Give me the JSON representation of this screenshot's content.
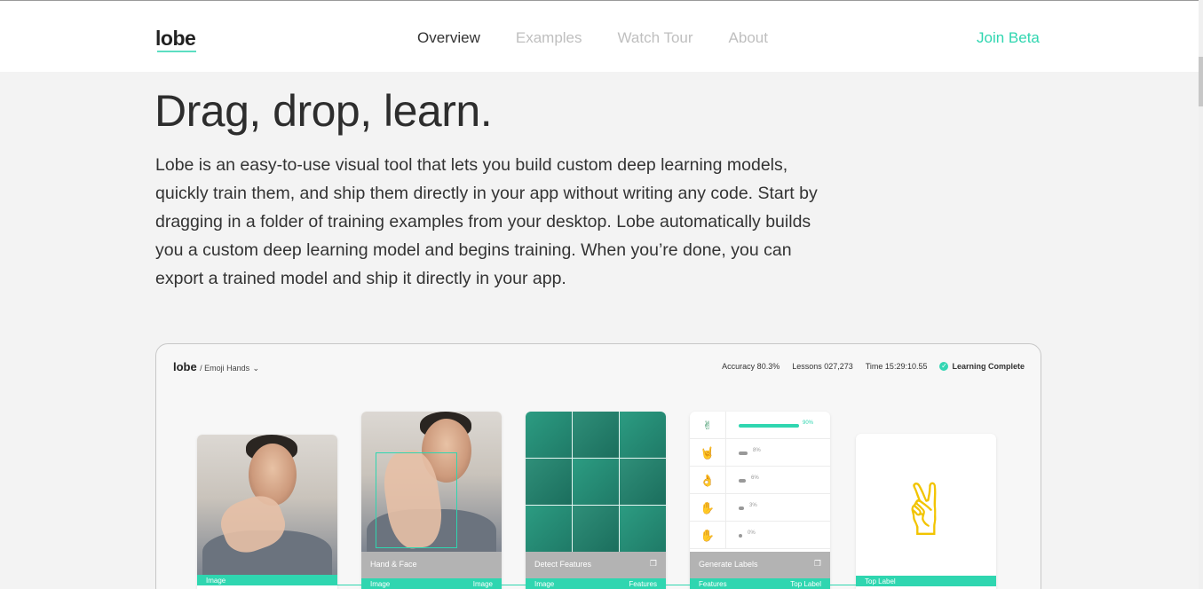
{
  "header": {
    "logo": "lobe",
    "nav": [
      {
        "label": "Overview",
        "active": true
      },
      {
        "label": "Examples",
        "active": false
      },
      {
        "label": "Watch Tour",
        "active": false
      },
      {
        "label": "About",
        "active": false
      }
    ],
    "cta": "Join Beta"
  },
  "hero": {
    "title": "Drag, drop, learn.",
    "body": "Lobe is an easy-to-use visual tool that lets you build custom deep learning models, quickly train them, and ship them directly in your app without writing any code. Start by dragging in a folder of training examples from your desktop. Lobe automatically builds you a custom deep learning model and begins training. When you’re done, you can export a trained model and ship it directly in your app."
  },
  "preview": {
    "app_name": "lobe",
    "project": "/ Emoji Hands",
    "chevron": "⌄",
    "accuracy": "Accuracy 80.3%",
    "lessons": "Lessons 027,273",
    "time": "Time 15:29:10.55",
    "status": "Learning Complete",
    "cards": [
      {
        "label": "",
        "foot_left": "Image",
        "foot_right": ""
      },
      {
        "label": "Hand & Face",
        "foot_left": "Image",
        "foot_right": "Image"
      },
      {
        "label": "Detect Features",
        "foot_left": "Image",
        "foot_right": "Features"
      },
      {
        "label": "Generate Labels",
        "foot_left": "Features",
        "foot_right": "Top Label"
      },
      {
        "label": "",
        "foot_left": "Top Label",
        "foot_right": ""
      }
    ],
    "label_rows": [
      {
        "emoji": "✌",
        "pct": "90%",
        "value": 0.9,
        "highlight": true
      },
      {
        "emoji": "🤘",
        "pct": "8%",
        "value": 0.08,
        "highlight": false
      },
      {
        "emoji": "👌",
        "pct": "6%",
        "value": 0.06,
        "highlight": false
      },
      {
        "emoji": "✋",
        "pct": "3%",
        "value": 0.03,
        "highlight": false
      },
      {
        "emoji": "✋",
        "pct": "0%",
        "value": 0.0,
        "highlight": false
      }
    ],
    "top_emoji": "✌"
  },
  "colors": {
    "accent": "#2fd6b0",
    "text": "#333333",
    "muted_nav": "#bfbfbf"
  }
}
